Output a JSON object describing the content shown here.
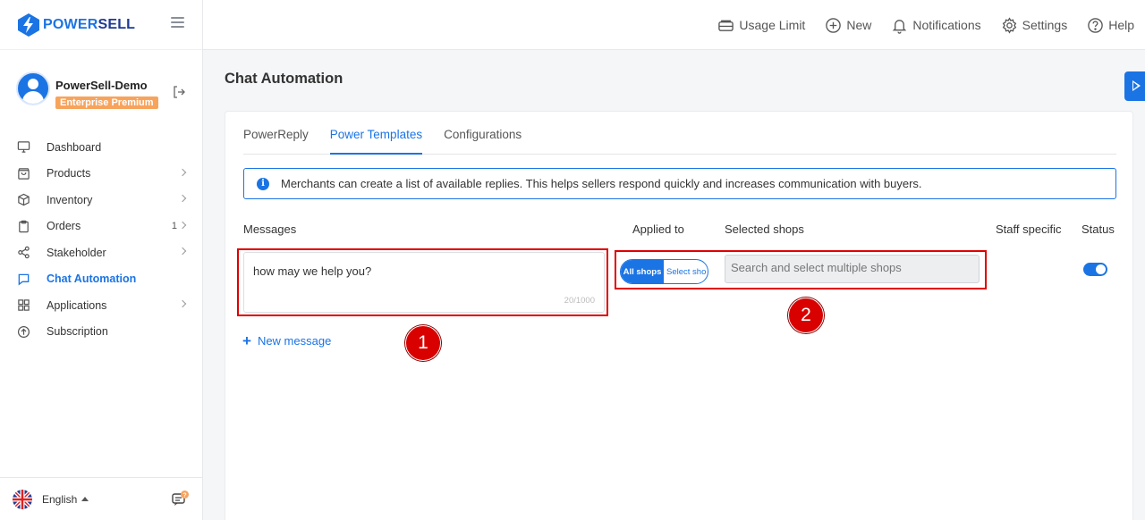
{
  "brand": {
    "name_part1": "POWER",
    "name_part2": "SELL"
  },
  "profile": {
    "name": "PowerSell-Demo",
    "plan": "Enterprise Premium"
  },
  "sidebar": {
    "items": [
      {
        "label": "Dashboard",
        "icon": "monitor-icon",
        "count": ""
      },
      {
        "label": "Products",
        "icon": "bag-icon",
        "count": ""
      },
      {
        "label": "Inventory",
        "icon": "box-icon",
        "count": ""
      },
      {
        "label": "Orders",
        "icon": "clipboard-icon",
        "count": "1"
      },
      {
        "label": "Stakeholder",
        "icon": "share-icon",
        "count": ""
      },
      {
        "label": "Chat Automation",
        "icon": "chat-icon",
        "count": ""
      },
      {
        "label": "Applications",
        "icon": "grid-icon",
        "count": ""
      },
      {
        "label": "Subscription",
        "icon": "arrow-up-circle-icon",
        "count": ""
      }
    ],
    "active_item": "Chat Automation"
  },
  "footer": {
    "language": "English"
  },
  "topbar": {
    "usage_limit": "Usage Limit",
    "new": "New",
    "notifications": "Notifications",
    "settings": "Settings",
    "help": "Help"
  },
  "page": {
    "title": "Chat Automation"
  },
  "tabs": [
    {
      "label": "PowerReply"
    },
    {
      "label": "Power Templates"
    },
    {
      "label": "Configurations"
    }
  ],
  "active_tab": "Power Templates",
  "info": {
    "text": "Merchants can create a list of available replies. This helps sellers respond quickly and increases communication with buyers."
  },
  "table": {
    "headers": {
      "messages": "Messages",
      "applied_to": "Applied to",
      "selected_shops": "Selected shops",
      "staff_specific": "Staff specific",
      "status": "Status"
    },
    "row": {
      "message": "how may we help you?",
      "char_count": "20/1000",
      "applied_all": "All shops",
      "applied_select": "Select sho",
      "shops_placeholder": "Search and select multiple shops",
      "status_on": true
    }
  },
  "actions": {
    "new_message": "New message"
  },
  "annotations": {
    "one": "1",
    "two": "2"
  },
  "colors": {
    "accent": "#1b74e4",
    "highlight": "#e00000",
    "badge": "#f7a35c"
  }
}
